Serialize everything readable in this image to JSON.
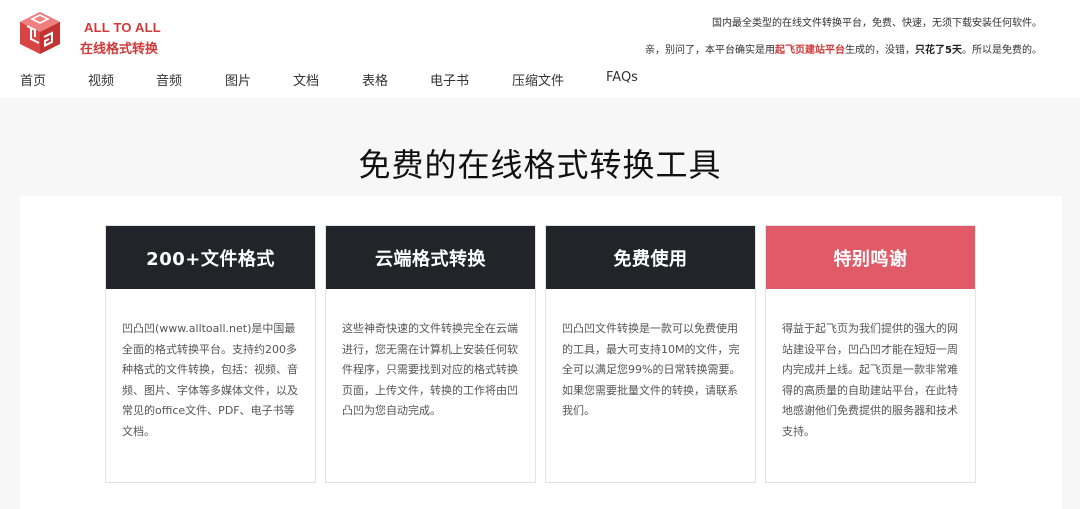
{
  "brand": {
    "name_en": "ALL TO ALL",
    "name_cn": "在线格式转换",
    "logo_icon": "cube-logo-icon",
    "accent": "#d03a3a"
  },
  "header": {
    "notice_line1": "国内最全类型的在线文件转换平台，免费、快速，无须下载安装任何软件。",
    "notice_line2_a": "亲，别问了，本平台确实是用",
    "notice_line2_link": "起飞页建站平台",
    "notice_line2_b": "生成的，没错，",
    "notice_line2_bold": "只花了5天",
    "notice_line2_c": "。所以是免费的。"
  },
  "nav": {
    "items": [
      {
        "label": "首页"
      },
      {
        "label": "视频"
      },
      {
        "label": "音频"
      },
      {
        "label": "图片"
      },
      {
        "label": "文档"
      },
      {
        "label": "表格"
      },
      {
        "label": "电子书"
      },
      {
        "label": "压缩文件"
      },
      {
        "label": "FAQs"
      }
    ]
  },
  "hero": {
    "title": "免费的在线格式转换工具"
  },
  "cards": [
    {
      "title": "200+文件格式",
      "body": "凹凸凹(www.alltoall.net)是中国最全面的格式转换平台。支持约200多种格式的文件转换，包括：视频、音频、图片、字体等多媒体文件，以及常见的office文件、PDF、电子书等文档。",
      "header_color": "#212429"
    },
    {
      "title": "云端格式转换",
      "body": "这些神奇快速的文件转换完全在云端进行，您无需在计算机上安装任何软件程序，只需要找到对应的格式转换页面，上传文件，转换的工作将由凹凸凹为您自动完成。",
      "header_color": "#212429"
    },
    {
      "title": "免费使用",
      "body": "凹凸凹文件转换是一款可以免费使用的工具，最大可支持10M的文件，完全可以满足您99%的日常转换需要。如果您需要批量文件的转换，请联系我们。",
      "header_color": "#212429"
    },
    {
      "title": "特别鸣谢",
      "body": "得益于起飞页为我们提供的强大的网站建设平台，凹凸凹才能在短短一周内完成并上线。起飞页是一款非常难得的高质量的自助建站平台，在此特地感谢他们免费提供的服务器和技术支持。",
      "header_color": "#e05a67"
    }
  ]
}
